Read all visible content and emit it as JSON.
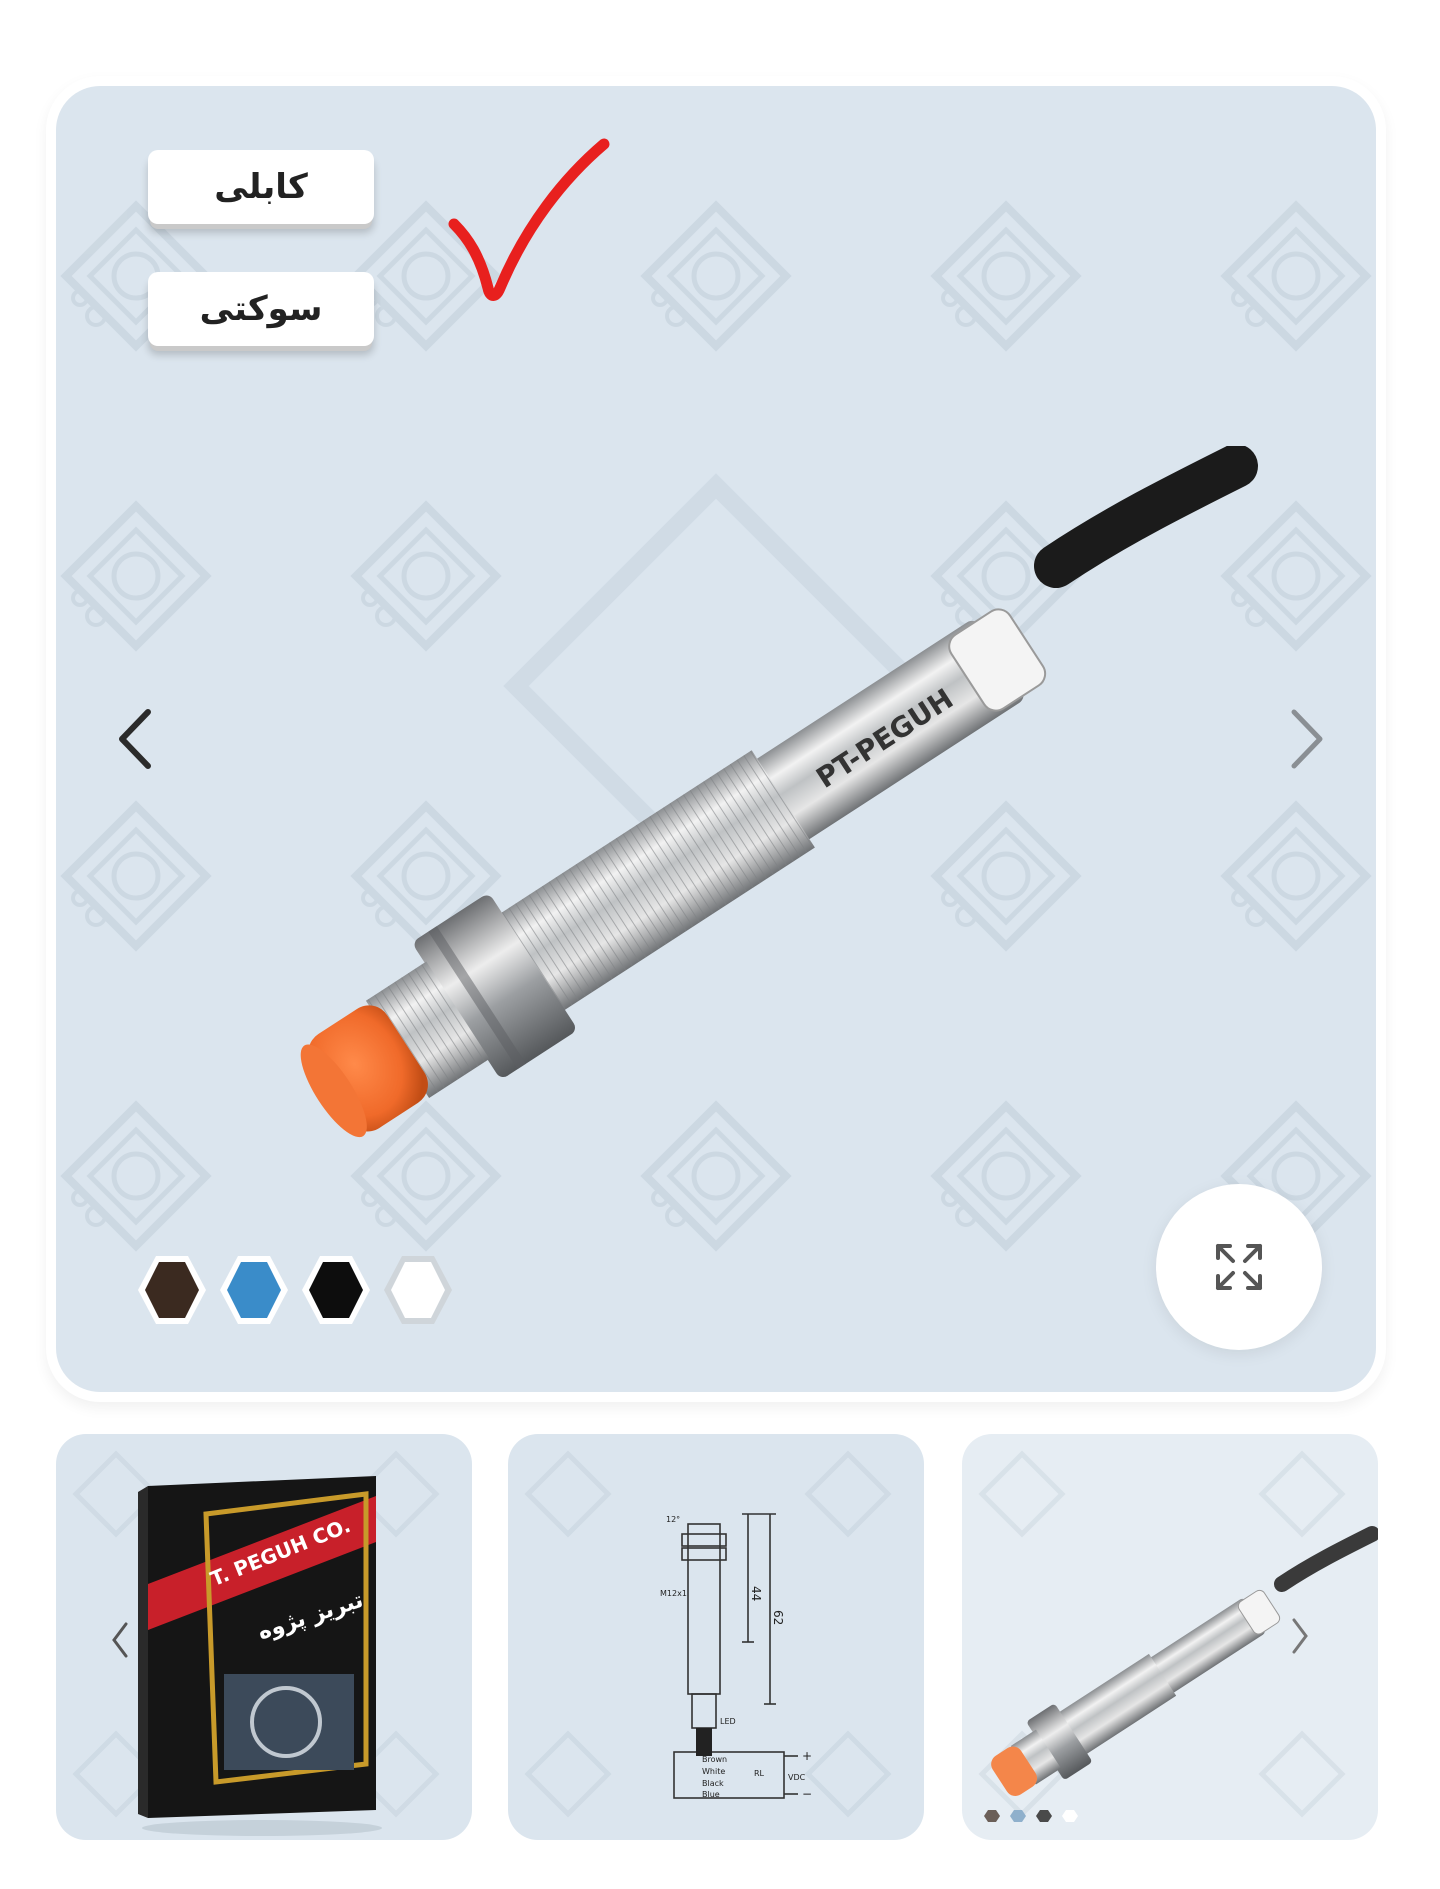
{
  "variants": {
    "cable_label": "کابلی",
    "socket_label": "سوکتی",
    "selected": "cable"
  },
  "product": {
    "engraving": "PT-PEGUH"
  },
  "colors": {
    "swatches": [
      "#3b2a20",
      "#3a8cc9",
      "#0d0d0d",
      "#ffffff"
    ],
    "cap": "#f06a2a",
    "check": "#e8201e"
  },
  "thumbnails": {
    "box": {
      "brand_en": "T. PEGUH CO.",
      "brand_fa": "تبریز پژوه"
    },
    "drawing": {
      "dim_44": "44",
      "dim_62": "62",
      "thread": "M12x1",
      "led": "LED",
      "wires": [
        "Brown",
        "White",
        "Black",
        "Blue"
      ],
      "supply": "VDC",
      "plus": "+",
      "minus": "−",
      "angle": "12°",
      "load": "RL"
    }
  }
}
